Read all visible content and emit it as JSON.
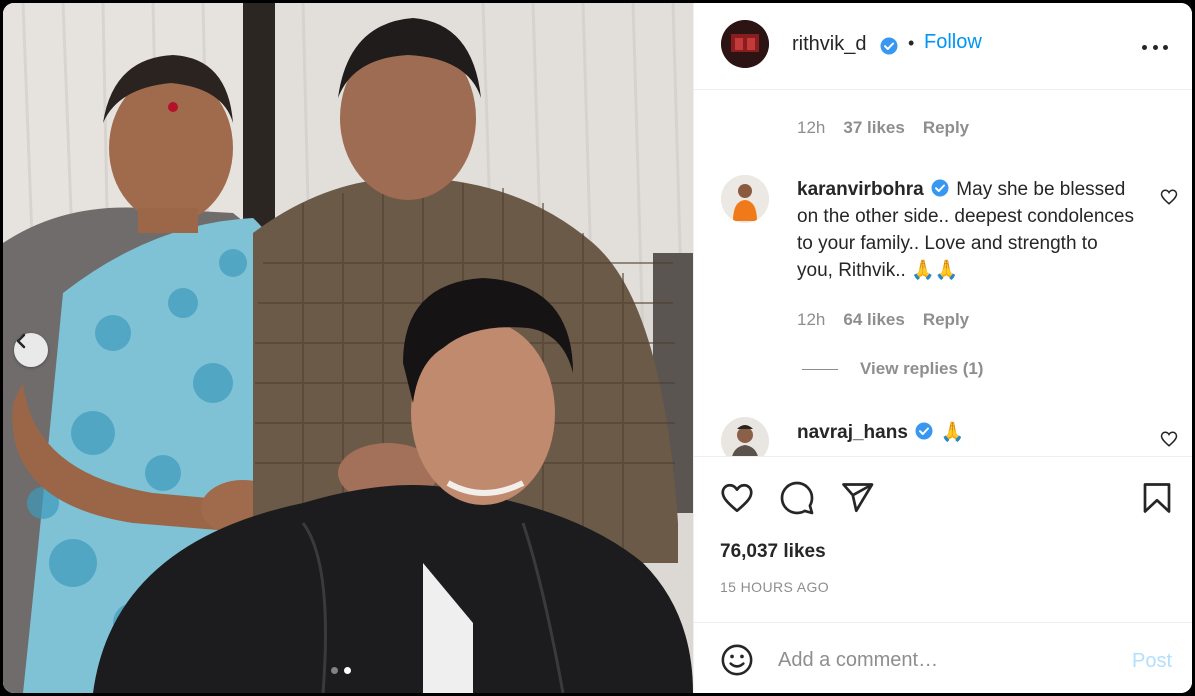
{
  "post": {
    "username": "rithvik_d",
    "separator": "•",
    "follow_label": "Follow",
    "carousel": {
      "current": 2,
      "total": 2
    }
  },
  "comments": {
    "first_meta": {
      "time": "12h",
      "likes": "37 likes",
      "reply": "Reply"
    },
    "karan": {
      "username": "karanvirbohra",
      "text": "May she be blessed on the other side.. deepest condolences to your family.. Love and strength to you, Rithvik.. 🙏🙏",
      "time": "12h",
      "likes": "64 likes",
      "reply": "Reply",
      "view_replies": "View replies (1)"
    },
    "navraj": {
      "username": "navraj_hans",
      "text": "🙏"
    }
  },
  "actions": {
    "likes": "76,037 likes",
    "time_ago": "15 HOURS AGO"
  },
  "add_comment": {
    "placeholder": "Add a comment…",
    "post_label": "Post"
  },
  "colors": {
    "link_blue": "#0095f6",
    "post_disabled": "#b2dffc",
    "muted": "#8e8e8e",
    "text": "#262626"
  }
}
